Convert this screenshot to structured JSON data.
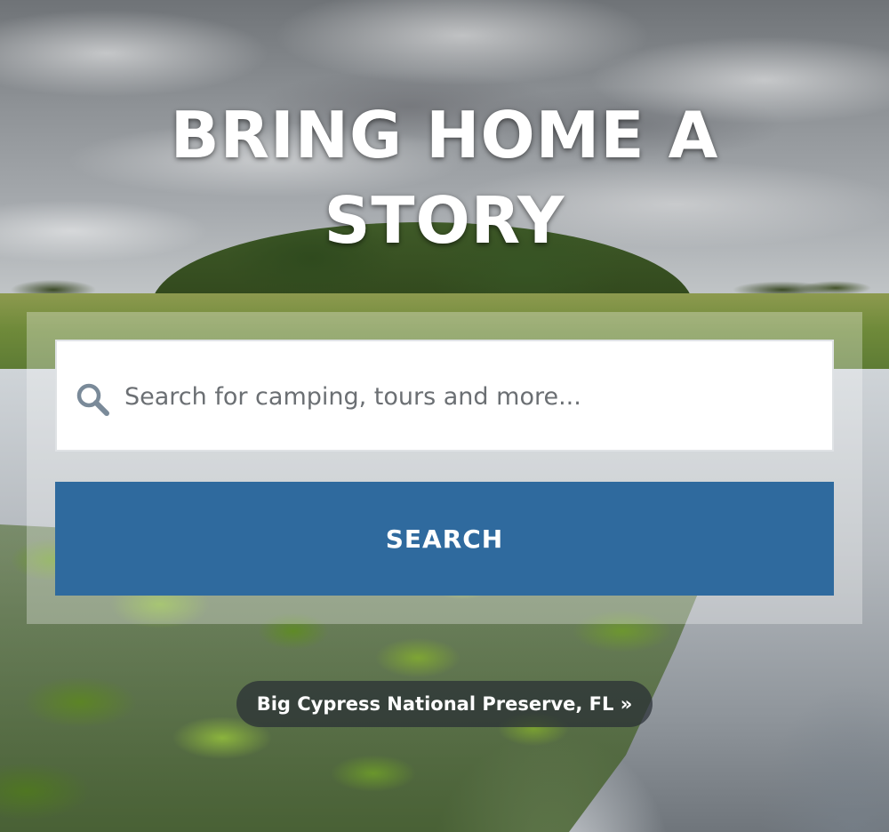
{
  "hero": {
    "headline": "BRING HOME A STORY"
  },
  "search": {
    "placeholder": "Search for camping, tours and more...",
    "value": "",
    "button_label": "SEARCH",
    "icon": "search-icon"
  },
  "photo_location": {
    "label": "Big Cypress National Preserve, FL »"
  },
  "colors": {
    "button_background": "#2f6a9e",
    "headline_text": "#ffffff",
    "pill_background": "#282e34"
  }
}
